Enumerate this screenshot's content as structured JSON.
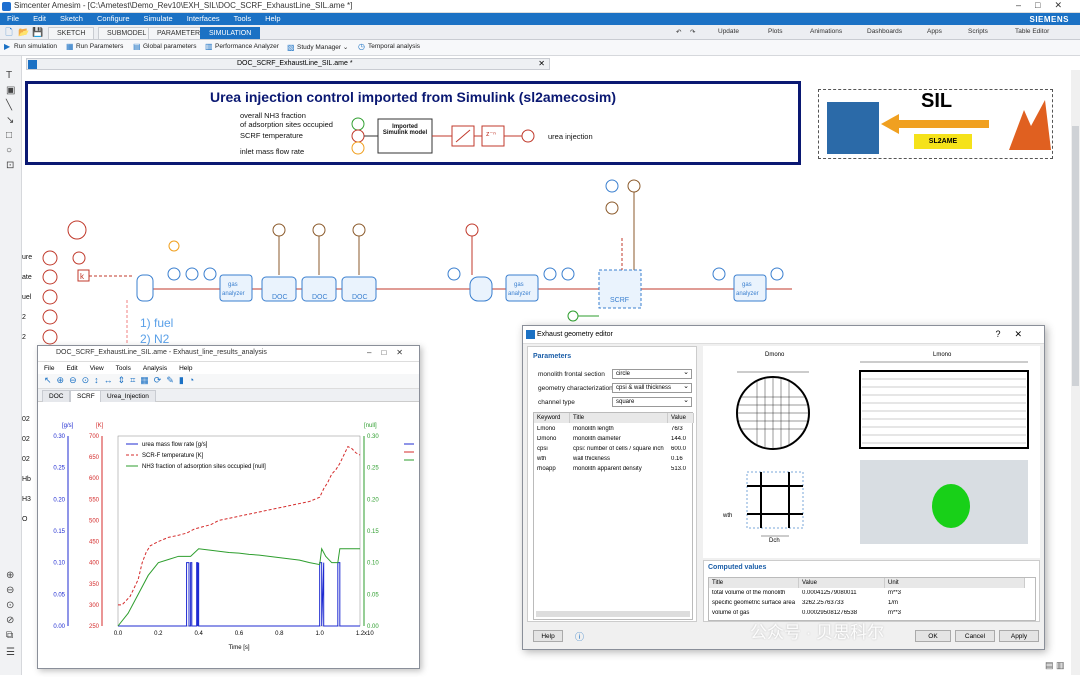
{
  "window": {
    "title": "Simcenter Amesim - [C:\\Ametest\\Demo_Rev10\\EXH_SIL\\DOC_SCRF_ExhaustLine_SIL.ame *]",
    "brand": "SIEMENS"
  },
  "menu": [
    "File",
    "Edit",
    "Sketch",
    "Configure",
    "Simulate",
    "Interfaces",
    "Tools",
    "Help"
  ],
  "mode_tabs": [
    "SKETCH",
    "SUBMODEL",
    "PARAMETER",
    "SIMULATION"
  ],
  "right_tools": [
    "Update",
    "Plots",
    "Animations",
    "Dashboards",
    "Apps",
    "Scripts",
    "Table Editor"
  ],
  "toolbar": [
    "Run simulation",
    "Run Parameters",
    "Global parameters",
    "Performance Analyzer",
    "Study Manager",
    "Temporal analysis"
  ],
  "doc_tab": "DOC_SCRF_ExhaustLine_SIL.ame *",
  "banner": {
    "title": "Urea injection control imported from Simulink (sl2amecosim)",
    "inputs": [
      "overall NH3 fraction",
      "of adsorption sites occupied",
      "SCRF temperature",
      "inlet mass flow rate"
    ],
    "block_label": "Imported Simulink model",
    "delay_label": "z⁻ⁿ",
    "output": "urea injection"
  },
  "sil_logo": {
    "title": "SIL",
    "arrow_label": "SL2AME"
  },
  "sketch_labels": {
    "left_signals": [
      "ure",
      "ate",
      "uel",
      "2",
      "2",
      "02",
      "02",
      "02",
      "Hb",
      "H3",
      "O"
    ],
    "fuel": [
      "1) fuel",
      "2) N2"
    ],
    "components": [
      "gas analyzer",
      "DOC",
      "DOC",
      "DOC",
      "gas analyzer",
      "SCRF",
      "gas analyzer"
    ],
    "sensors": [
      "m",
      "T",
      "T",
      "T",
      "P",
      "P",
      "T"
    ]
  },
  "results_window": {
    "title": "DOC_SCRF_ExhaustLine_SIL.ame - Exhaust_line_results_analysis",
    "menu": [
      "File",
      "Edit",
      "View",
      "Tools",
      "Analysis",
      "Help"
    ],
    "tabs": [
      "DOC",
      "SCRF",
      "Urea_Injection"
    ],
    "active_tab": "SCRF"
  },
  "chart_data": {
    "type": "line",
    "title": "",
    "xlabel": "Time [s]",
    "x_multiplier": "x10",
    "xlim": [
      0,
      1.2
    ],
    "xticks": [
      "0.0",
      "0.2",
      "0.4",
      "0.6",
      "0.8",
      "1.0",
      "1.2"
    ],
    "axes": [
      {
        "unit": "[g/s]",
        "color": "#1f2bd1",
        "range": [
          0,
          0.3
        ],
        "ticks": [
          "0.00",
          "0.05",
          "0.10",
          "0.15",
          "0.20",
          "0.25",
          "0.30"
        ]
      },
      {
        "unit": "[K]",
        "color": "#d42b2b",
        "range": [
          250,
          700
        ],
        "ticks": [
          "250",
          "300",
          "350",
          "400",
          "450",
          "500",
          "550",
          "600",
          "650",
          "700"
        ]
      },
      {
        "unit": "[null]",
        "color": "#2e9e2e",
        "range": [
          0,
          0.3
        ],
        "ticks": [
          "0.00",
          "0.05",
          "0.10",
          "0.15",
          "0.20",
          "0.25",
          "0.30"
        ]
      }
    ],
    "legend": [
      "urea mass flow rate [g/s]",
      "SCR-F temperature [K]",
      "NH3 fraction of adsorption sites occupied [null]"
    ],
    "series": [
      {
        "name": "urea mass flow rate [g/s]",
        "color": "#1f2bd1",
        "axis": 0,
        "x": [
          0,
          0.34,
          0.34,
          0.352,
          0.352,
          0.36,
          0.36,
          0.366,
          0.366,
          0.39,
          0.39,
          0.395,
          0.395,
          0.4,
          0.4,
          1.0,
          1.0,
          1.01,
          1.01,
          1.02,
          1.02,
          1.09,
          1.09,
          1.1,
          1.1,
          1.2
        ],
        "y": [
          0,
          0,
          0.1,
          0.1,
          0,
          0,
          0.1,
          0.1,
          0,
          0,
          0.1,
          0.1,
          0,
          0.1,
          0,
          0,
          0.1,
          0.1,
          0,
          0.1,
          0,
          0,
          0.1,
          0.1,
          0,
          0
        ]
      },
      {
        "name": "SCR-F temperature [K]",
        "color": "#d42b2b",
        "axis": 1,
        "dashed": true,
        "x": [
          0,
          0.02,
          0.04,
          0.06,
          0.08,
          0.1,
          0.12,
          0.14,
          0.16,
          0.2,
          0.25,
          0.3,
          0.34,
          0.38,
          0.42,
          0.46,
          0.5,
          0.55,
          0.6,
          0.65,
          0.7,
          0.75,
          0.8,
          0.85,
          0.9,
          0.95,
          1.0,
          1.02,
          1.04,
          1.06,
          1.08,
          1.1,
          1.12,
          1.14,
          1.16,
          1.18,
          1.2
        ],
        "y": [
          300,
          300,
          310,
          320,
          340,
          360,
          400,
          425,
          440,
          450,
          460,
          465,
          470,
          480,
          485,
          490,
          500,
          505,
          510,
          515,
          520,
          525,
          530,
          535,
          540,
          545,
          555,
          575,
          590,
          610,
          620,
          635,
          655,
          675,
          670,
          660,
          655
        ]
      },
      {
        "name": "NH3 fraction of adsorption sites occupied [null]",
        "color": "#2e9e2e",
        "axis": 2,
        "x": [
          0,
          0.05,
          0.1,
          0.15,
          0.2,
          0.25,
          0.3,
          0.33,
          0.36,
          0.4,
          0.45,
          0.5,
          0.55,
          0.6,
          0.65,
          0.7,
          0.75,
          0.8,
          0.85,
          0.9,
          0.95,
          1.0,
          1.01,
          1.03,
          1.06,
          1.09,
          1.1,
          1.2
        ],
        "y": [
          0.0,
          0.02,
          0.05,
          0.08,
          0.1,
          0.105,
          0.11,
          0.11,
          0.11,
          0.122,
          0.12,
          0.118,
          0.116,
          0.115,
          0.113,
          0.112,
          0.11,
          0.108,
          0.106,
          0.104,
          0.1,
          0.097,
          0.122,
          0.11,
          0.1,
          0.1,
          0.122,
          0.122
        ]
      }
    ]
  },
  "geometry_editor": {
    "title": "Exhaust geometry editor",
    "section_params": "Parameters",
    "fields": [
      {
        "label": "monolith frontal section",
        "value": "circle"
      },
      {
        "label": "geometry characterization",
        "value": "cpsi & wall thickness"
      },
      {
        "label": "channel type",
        "value": "square"
      }
    ],
    "table_headers": [
      "Keyword",
      "Title",
      "Value"
    ],
    "table_rows": [
      [
        "Lmono",
        "monolith length",
        "76/3"
      ],
      [
        "Dmono",
        "monolith diameter",
        "144.0"
      ],
      [
        "cpsi",
        "cpsi: number of cells / square inch",
        "600.0"
      ],
      [
        "wth",
        "wall thickness",
        "0.16"
      ],
      [
        "rhoapp",
        "monolith apparent density",
        "513.0"
      ]
    ],
    "diagram_labels": {
      "dmono": "Dmono",
      "lmono": "Lmono",
      "wth": "wth",
      "dch": "Dch"
    },
    "computed_section": "Computed values",
    "computed_headers": [
      "Title",
      "Value",
      "Unit"
    ],
    "computed_rows": [
      [
        "total volume of the monolith",
        "0.000412579080011",
        "m**3"
      ],
      [
        "specific geometric surface area",
        "3262.25763733",
        "1/m"
      ],
      [
        "volume of gas",
        "0.000295081276538",
        "m**3"
      ]
    ],
    "buttons": {
      "help": "Help",
      "ok": "OK",
      "cancel": "Cancel",
      "apply": "Apply"
    }
  },
  "watermark": "公众号 · 贝思科尔"
}
